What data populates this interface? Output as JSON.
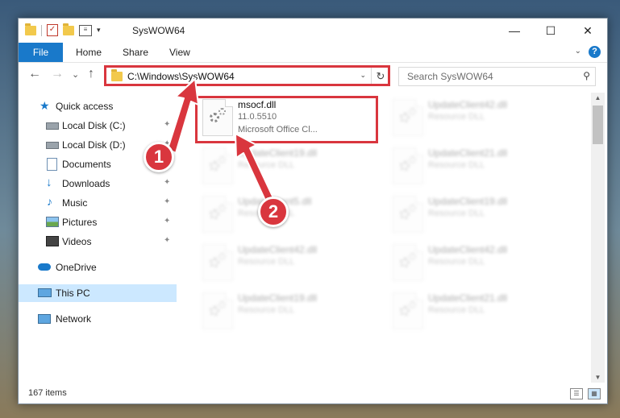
{
  "window": {
    "title": "SysWOW64",
    "minimize_glyph": "—",
    "maximize_glyph": "☐",
    "close_glyph": "✕"
  },
  "ribbon": {
    "tabs": [
      "File",
      "Home",
      "Share",
      "View"
    ],
    "help_glyph": "?",
    "expand_glyph": "⌄"
  },
  "nav": {
    "back_glyph": "←",
    "forward_glyph": "→",
    "recent_glyph": "⌄",
    "up_glyph": "↑",
    "address": "C:\\Windows\\SysWOW64",
    "address_dropdown_glyph": "⌄",
    "refresh_glyph": "↻",
    "search_placeholder": "Search SysWOW64",
    "search_glyph": "⚲"
  },
  "sidebar": {
    "items": [
      {
        "label": "Quick access",
        "icon": "star-icon"
      },
      {
        "label": "Local Disk (C:)",
        "icon": "drive-icon",
        "pinned": true
      },
      {
        "label": "Local Disk (D:)",
        "icon": "drive-icon",
        "pinned": true
      },
      {
        "label": "Documents",
        "icon": "documents-icon",
        "pinned": true
      },
      {
        "label": "Downloads",
        "icon": "download-icon",
        "pinned": true
      },
      {
        "label": "Music",
        "icon": "music-icon",
        "pinned": true
      },
      {
        "label": "Pictures",
        "icon": "pictures-icon",
        "pinned": true
      },
      {
        "label": "Videos",
        "icon": "videos-icon",
        "pinned": true
      },
      {
        "label": "OneDrive",
        "icon": "cloud-icon"
      },
      {
        "label": "This PC",
        "icon": "computer-icon",
        "selected": true
      },
      {
        "label": "Network",
        "icon": "network-icon"
      }
    ],
    "pin_glyph": "📌"
  },
  "files": {
    "highlighted": {
      "name": "msocf.dll",
      "version": "11.0.5510",
      "description": "Microsoft Office Cl..."
    },
    "blurred": [
      {
        "name": "UpdateClient42.dll",
        "type": "Resource DLL"
      },
      {
        "name": "UpdateClient19.dll",
        "type": "Resource DLL"
      },
      {
        "name": "UpdateClient21.dll",
        "type": "Resource DLL"
      },
      {
        "name": "UpdateClient5.dll",
        "type": "Resource DLL"
      },
      {
        "name": "UpdateClient19.dll",
        "type": "Resource DLL"
      },
      {
        "name": "UpdateClient42.dll",
        "type": "Resource DLL"
      },
      {
        "name": "UpdateClient42.dll",
        "type": "Resource DLL"
      },
      {
        "name": "UpdateClient19.dll",
        "type": "Resource DLL"
      },
      {
        "name": "UpdateClient21.dll",
        "type": "Resource DLL"
      }
    ]
  },
  "status": {
    "item_count": "167 items"
  },
  "callouts": {
    "one": "1",
    "two": "2"
  },
  "colors": {
    "accent": "#1979ca",
    "callout_red": "#d9363e",
    "selection": "#cce8ff"
  }
}
